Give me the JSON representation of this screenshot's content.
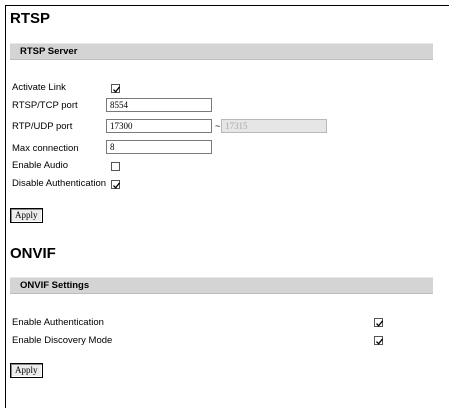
{
  "rtsp": {
    "title": "RTSP",
    "section_label": "RTSP Server",
    "activate_link_label": "Activate Link",
    "activate_link_checked": true,
    "tcp_port_label": "RTSP/TCP port",
    "tcp_port_value": "8554",
    "udp_port_label": "RTP/UDP port",
    "udp_port_value": "17300",
    "udp_range_separator": "~",
    "udp_port_end_value": "17315",
    "max_connection_label": "Max connection",
    "max_connection_value": "8",
    "enable_audio_label": "Enable Audio",
    "enable_audio_checked": false,
    "disable_auth_label": "Disable Authentication",
    "disable_auth_checked": true,
    "apply_label": "Apply"
  },
  "onvif": {
    "title": "ONVIF",
    "section_label": "ONVIF Settings",
    "enable_auth_label": "Enable Authentication",
    "enable_auth_checked": true,
    "enable_discovery_label": "Enable Discovery Mode",
    "enable_discovery_checked": true,
    "apply_label": "Apply"
  }
}
